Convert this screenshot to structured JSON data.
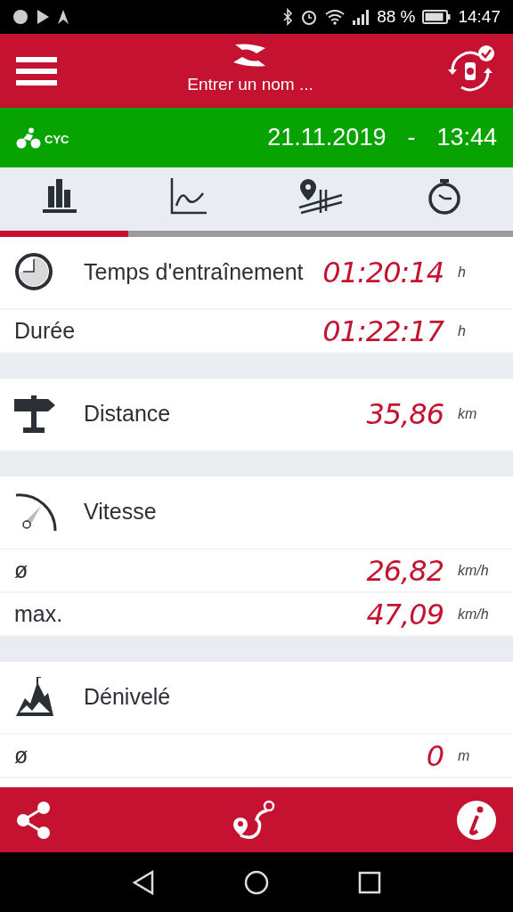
{
  "status_bar": {
    "battery": "88 %",
    "time": "14:47"
  },
  "header": {
    "placeholder": "Entrer un nom ..."
  },
  "activity": {
    "label": "CYC",
    "date": "21.11.2019",
    "separator": "-",
    "time": "13:44"
  },
  "tabs": [
    {
      "kind": "bars",
      "selected": true
    },
    {
      "kind": "curve",
      "selected": false
    },
    {
      "kind": "route",
      "selected": false
    },
    {
      "kind": "stopwatch",
      "selected": false
    }
  ],
  "sections": [
    {
      "kind": "clock",
      "title": "Temps d'entraînement",
      "value": "01:20:14",
      "unit": "h",
      "rows": [
        {
          "label": "Durée",
          "value": "01:22:17",
          "unit": "h"
        }
      ]
    },
    {
      "kind": "signpost",
      "title": "Distance",
      "value": "35,86",
      "unit": "km"
    },
    {
      "kind": "speed",
      "title": "Vitesse",
      "rows": [
        {
          "label": "ø",
          "value": "26,82",
          "unit": "km/h"
        },
        {
          "label": "max.",
          "value": "47,09",
          "unit": "km/h"
        }
      ]
    },
    {
      "kind": "mountain",
      "title": "Dénivelé",
      "rows": [
        {
          "label": "ø",
          "value": "0",
          "unit": "m"
        }
      ]
    }
  ]
}
